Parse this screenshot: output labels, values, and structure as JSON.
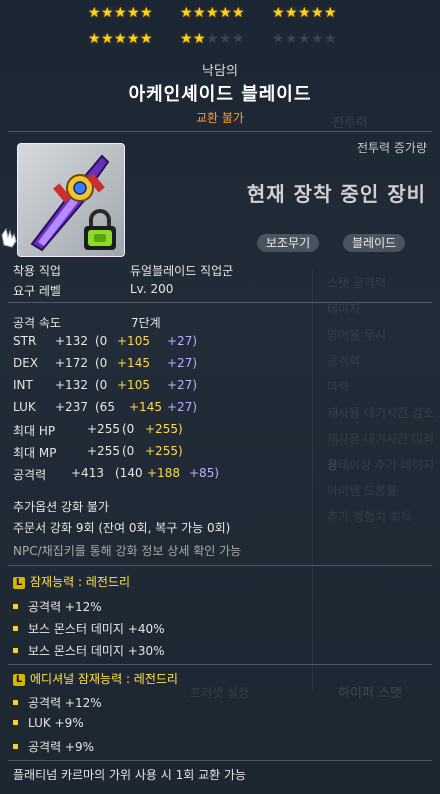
{
  "stars": {
    "row1": {
      "group1": 5,
      "group2": 5,
      "group3": 5
    },
    "row2": {
      "group1": 5,
      "group2": 2,
      "group3": 0
    },
    "per_group": 5,
    "on_color": "#ffd21a",
    "off_color": "#3a4450"
  },
  "item": {
    "prefix": "낙담의",
    "name": "아케인셰이드 블레이드",
    "trade": "교환 불가",
    "icon": "arcane-blade-icon",
    "lock_icon": "green-lock-icon"
  },
  "compare": {
    "label": "전투력 증가량",
    "title": "현재 장착 중인 장비",
    "tags": [
      "보조무기",
      "블레이드"
    ]
  },
  "requirements": [
    {
      "label": "착용 직업",
      "value": "듀얼블레이드 직업군"
    },
    {
      "label": "요구 레벨",
      "value": "Lv. 200"
    }
  ],
  "attack_speed": {
    "label": "공격 속도",
    "value": "7단계"
  },
  "stats": [
    {
      "label": "STR",
      "total": "+132",
      "base": "(0",
      "bonus1": "+105",
      "bonus2": "+27)"
    },
    {
      "label": "DEX",
      "total": "+172",
      "base": "(0",
      "bonus1": "+145",
      "bonus2": "+27)"
    },
    {
      "label": "INT",
      "total": "+132",
      "base": "(0",
      "bonus1": "+105",
      "bonus2": "+27)"
    },
    {
      "label": "LUK",
      "total": "+237",
      "base": "(65",
      "bonus1": "+145",
      "bonus2": "+27)"
    },
    {
      "label": "최대 HP",
      "total": "+255",
      "base": "(0",
      "bonus1": "+255)",
      "bonus2": ""
    },
    {
      "label": "최대 MP",
      "total": "+255",
      "base": "(0",
      "bonus1": "+255)",
      "bonus2": ""
    },
    {
      "label": "공격력",
      "total": "+413",
      "base": "(140",
      "bonus1": "+188",
      "bonus2": "+85)"
    }
  ],
  "upgrades": {
    "line1": "추가옵션 강화 불가",
    "line2": "주문서 강화 9회 (잔여 0회, 복구 가능 0회)",
    "line3": "NPC/채집키를 통해 강화 정보 상세 확인 가능"
  },
  "potential": {
    "badge": "L",
    "title": "잠재능력 : 레전드리",
    "lines": [
      "공격력 +12%",
      "보스 몬스터 데미지 +40%",
      "보스 몬스터 데미지 +30%"
    ]
  },
  "additional": {
    "badge": "L",
    "title": "에디셔널 잠재능력 : 레전드리",
    "lines": [
      "공격력 +12%",
      "LUK +9%",
      "공격력 +9%"
    ]
  },
  "footer": "플래티넘 카르마의 가위 사용 시 1회 교환 가능",
  "background_ghost": {
    "top_right": "전투력",
    "panel_items": [
      "스탯 공격력",
      "데미지",
      "방어율 무시",
      "공격력",
      "마력",
      "재사용 대기시간 감소",
      "재사용 대기시간 미적용",
      "상태이상 추가 데미지",
      "아이템 드롭률",
      "추가 경험치 획득"
    ],
    "panel_footer": "하이퍼 스탯",
    "bottom_left": "프리셋 설정"
  }
}
